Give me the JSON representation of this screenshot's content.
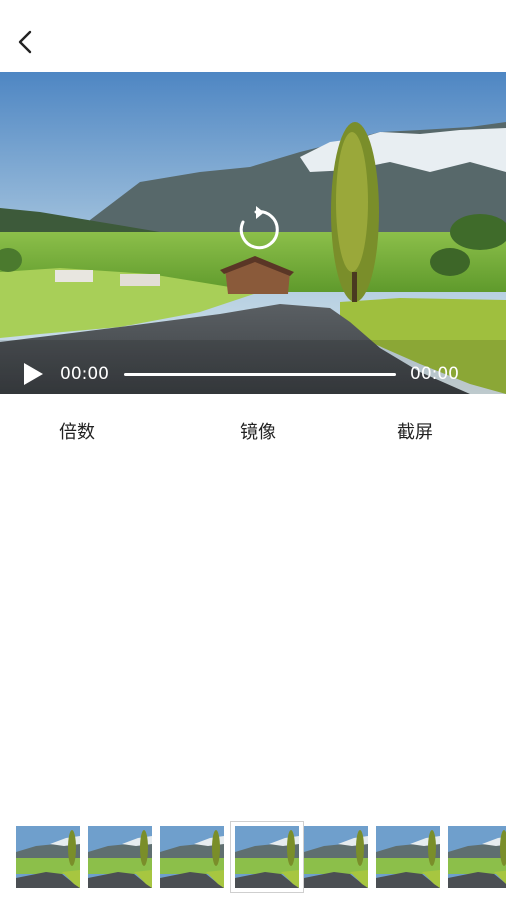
{
  "header": {
    "back_icon": "chevron-left-icon"
  },
  "player": {
    "center_icon": "replay-icon",
    "play_icon": "play-icon",
    "current_time": "00:00",
    "duration": "00:00",
    "progress": 0
  },
  "options": [
    {
      "label": "倍数"
    },
    {
      "label": "镜像"
    },
    {
      "label": "截屏"
    }
  ],
  "filmstrip": {
    "count": 7,
    "selected_index": 3
  }
}
